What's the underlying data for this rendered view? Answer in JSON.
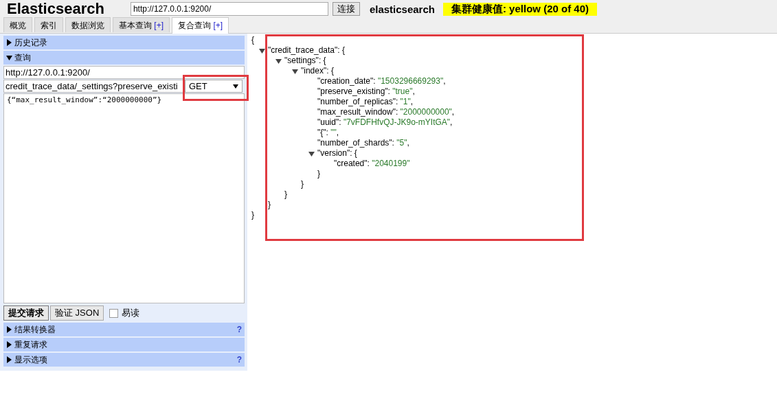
{
  "header": {
    "title": "Elasticsearch",
    "url": "http://127.0.0.1:9200/",
    "connect_button": "连接",
    "cluster_name": "elasticsearch",
    "health": "集群健康值: yellow (20 of 40)"
  },
  "tabs": [
    {
      "label": "概览",
      "selected": false
    },
    {
      "label": "索引",
      "selected": false
    },
    {
      "label": "数据浏览",
      "selected": false
    },
    {
      "label": "基本查询",
      "extra": "[+]",
      "selected": false
    },
    {
      "label": "复合查询",
      "extra": "[+]",
      "selected": true
    }
  ],
  "sections_top": [
    {
      "label": "历史记录",
      "expanded": false
    },
    {
      "label": "查询",
      "expanded": true
    }
  ],
  "query": {
    "server": "http://127.0.0.1:9200/",
    "path": "credit_trace_data/_settings?preserve_existi",
    "method": "GET",
    "body": "{“max_result_window”:“2000000000”}",
    "submit": "提交请求",
    "validate": "验证 JSON",
    "pretty_label": "易读",
    "pretty_checked": false
  },
  "sections_bottom": [
    {
      "label": "结果转换器",
      "expanded": false,
      "help": "?"
    },
    {
      "label": "重复请求",
      "expanded": false
    },
    {
      "label": "显示选项",
      "expanded": false,
      "help": "?"
    }
  ],
  "result": {
    "open": "{",
    "close": "}",
    "nodes": [
      {
        "label": "\"credit_trace_data\": {",
        "expanded": true,
        "close": "}",
        "children": [
          {
            "label": "\"settings\": {",
            "expanded": true,
            "close": "}",
            "children": [
              {
                "label": "\"index\": {",
                "expanded": true,
                "close": "}",
                "children": [
                  {
                    "key": "\"creation_date\": ",
                    "value": "\"1503296669293\"",
                    "tail": ","
                  },
                  {
                    "key": "\"preserve_existing\": ",
                    "value": "\"true\"",
                    "tail": ","
                  },
                  {
                    "key": "\"number_of_replicas\": ",
                    "value": "\"1\"",
                    "tail": ","
                  },
                  {
                    "key": "\"max_result_window\": ",
                    "value": "\"2000000000\"",
                    "tail": ","
                  },
                  {
                    "key": "\"uuid\": ",
                    "value": "\"7vFDFHfvQJ-JK9o-mYItGA\"",
                    "tail": ","
                  },
                  {
                    "key": "\"{\": ",
                    "value": "\"\"",
                    "tail": ","
                  },
                  {
                    "key": "\"number_of_shards\": ",
                    "value": "\"5\"",
                    "tail": ","
                  },
                  {
                    "label": "\"version\": {",
                    "expanded": true,
                    "close": "}",
                    "children": [
                      {
                        "key": "\"created\": ",
                        "value": "\"2040199\""
                      }
                    ]
                  }
                ]
              }
            ]
          }
        ]
      }
    ]
  }
}
